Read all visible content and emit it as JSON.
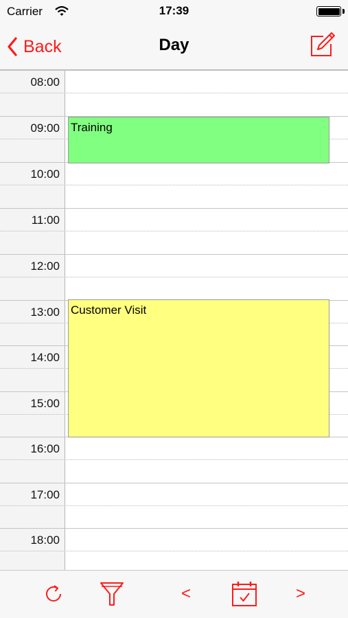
{
  "status_bar": {
    "carrier": "Carrier",
    "time": "17:39"
  },
  "nav": {
    "back_label": "Back",
    "title": "Day"
  },
  "calendar": {
    "hours": [
      "08:00",
      "09:00",
      "10:00",
      "11:00",
      "12:00",
      "13:00",
      "14:00",
      "15:00",
      "16:00",
      "17:00",
      "18:00"
    ],
    "events": [
      {
        "title": "Training",
        "start": "09:00",
        "end": "10:00",
        "color": "#80ff80"
      },
      {
        "title": "Customer Visit",
        "start": "13:00",
        "end": "16:00",
        "color": "#ffff80"
      }
    ]
  },
  "toolbar": {
    "prev_label": "<",
    "next_label": ">"
  },
  "colors": {
    "accent": "#ff1a1a"
  },
  "icons": [
    "back-chevron-icon",
    "compose-icon",
    "refresh-icon",
    "filter-icon",
    "calendar-today-icon"
  ]
}
